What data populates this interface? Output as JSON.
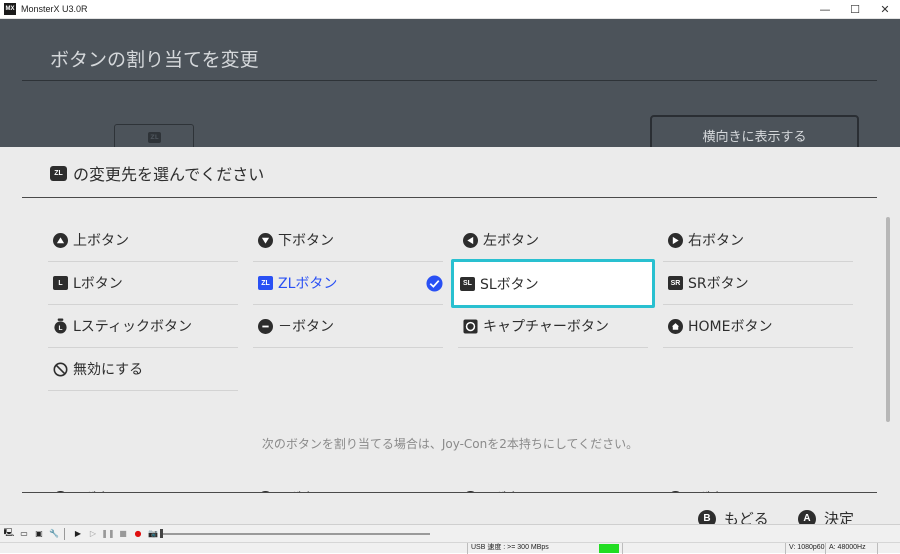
{
  "window": {
    "title": "MonsterX U3.0R",
    "icon_text": "MX",
    "minimize": "—",
    "maximize": "☐",
    "close": "✕"
  },
  "background_screen": {
    "title": "ボタンの割り当てを変更",
    "zl_glyph": "ZL",
    "landscape_button": "横向きに表示する"
  },
  "dialog": {
    "title_glyph": "ZL",
    "title": "の変更先を選んでください",
    "options": [
      {
        "label": "上ボタン",
        "icon": "dpad-up-icon"
      },
      {
        "label": "下ボタン",
        "icon": "dpad-down-icon"
      },
      {
        "label": "左ボタン",
        "icon": "dpad-left-icon"
      },
      {
        "label": "右ボタン",
        "icon": "dpad-right-icon"
      },
      {
        "label": "Lボタン",
        "icon": "l-button-icon",
        "glyph": "L"
      },
      {
        "label": "ZLボタン",
        "icon": "zl-button-icon",
        "glyph": "ZL",
        "selected": true
      },
      {
        "label": "SLボタン",
        "icon": "sl-button-icon",
        "glyph": "SL",
        "focused": true
      },
      {
        "label": "SRボタン",
        "icon": "sr-button-icon",
        "glyph": "SR"
      },
      {
        "label": "Lスティックボタン",
        "icon": "l-stick-icon"
      },
      {
        "label": "－ボタン",
        "icon": "minus-button-icon"
      },
      {
        "label": "キャプチャーボタン",
        "icon": "capture-button-icon"
      },
      {
        "label": "HOMEボタン",
        "icon": "home-button-icon"
      },
      {
        "label": "無効にする",
        "icon": "disable-icon"
      }
    ],
    "note": "次のボタンを割り当てる場合は、Joy-Conを2本持ちにしてください。",
    "partial_options": [
      {
        "label": "Aボタン",
        "glyph": "A"
      },
      {
        "label": "Bボタン",
        "glyph": "B"
      },
      {
        "label": "Xボタン",
        "glyph": "X"
      },
      {
        "label": "Yボタン",
        "glyph": "Y"
      }
    ],
    "footer": {
      "back_glyph": "B",
      "back_label": "もどる",
      "ok_glyph": "A",
      "ok_label": "決定"
    }
  },
  "colors": {
    "accent_blue": "#2950f4",
    "focus_cyan": "#29c0d0",
    "text_dark": "#2d2d2d",
    "dim_overlay": "#4c535a"
  },
  "statusbar": {
    "usb_speed": "USB 速度 : >= 300 MBps",
    "video": "V: 1080p60",
    "audio": "A: 48000Hz"
  }
}
